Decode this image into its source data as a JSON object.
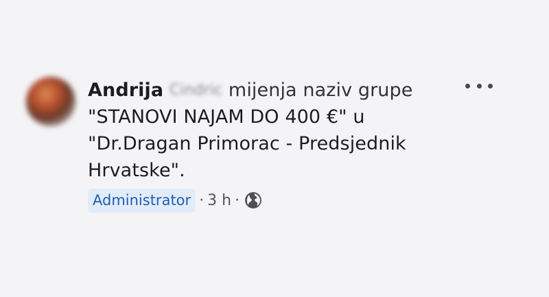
{
  "post": {
    "author_first": "Andrija",
    "author_last_hidden": "Cindric",
    "action_text": "mijenja naziv grupe",
    "line2": "\"STANOVI NAJAM DO 400 €\" u",
    "line3": "\"Dr.Dragan Primorac - Predsjednik",
    "line4": "Hrvatske\"."
  },
  "meta": {
    "role_badge": "Administrator",
    "separator": "·",
    "time": "3 h",
    "audience_icon": "globe-icon"
  },
  "menu": {
    "icon": "more-options-icon"
  }
}
